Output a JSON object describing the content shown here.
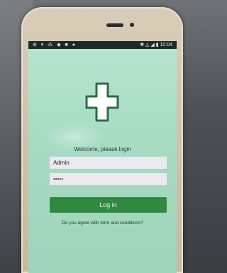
{
  "status_bar": {
    "left_icons": "⊕ ▾ ⁂ ◆ ■ ●",
    "right_icons": "✱ ◬ ◢ ▮",
    "time": "10:04"
  },
  "login": {
    "welcome_text": "Welcome, please login",
    "username_value": "Admin",
    "password_value": "•••••",
    "login_button_label": "Log in",
    "terms_link_text": "Do you agree with term and conditions?"
  },
  "colors": {
    "screen_bg": "#a8dcc3",
    "cross_fill": "#ffffff",
    "cross_border": "#2c6e3f",
    "button_bg": "#2f8a3f",
    "input_bg": "#e9e9ef"
  },
  "icons": {
    "logo": "green-cross-icon"
  }
}
